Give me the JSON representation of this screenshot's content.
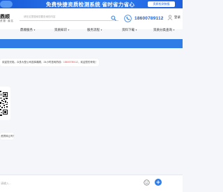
{
  "banner": {
    "text": "免费快捷资质检测系统 省时省力省心",
    "button_label": "资质检测快报"
  },
  "header": {
    "brand": "鼎顺",
    "brand_sub": "资 服 · 鼎 名",
    "search_placeholder": "请在这里搜索您要查询的内容",
    "phone": "18600789112",
    "login": "登录"
  },
  "nav": {
    "items": [
      {
        "label": "鼎顺服务"
      },
      {
        "label": "资质知识"
      },
      {
        "label": "服务流程"
      },
      {
        "label": "资料下载"
      },
      {
        "label": "资质分类查询"
      }
    ]
  },
  "chat": {
    "message_1_pre": "欢迎您光临，众多大型公司选择鼎顺，24小时咨询热线：",
    "message_1_highlight": "18600789112",
    "message_1_post": "，欢迎您的来电！",
    "message_2": "资质转让吗？"
  },
  "input": {
    "placeholder": "请输入..."
  },
  "colors": {
    "brand_blue": "#2e7de6",
    "highlight_red": "#e64545"
  }
}
